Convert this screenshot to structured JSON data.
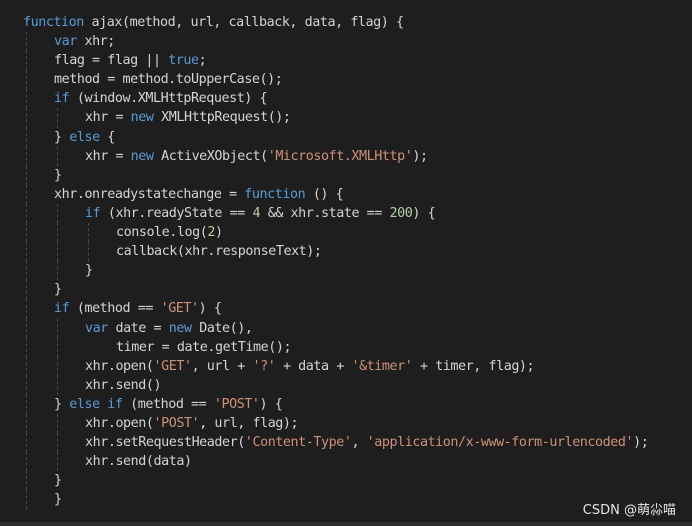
{
  "code_lines": [
    {
      "indent": 0,
      "guides": [],
      "tokens": [
        [
          "function",
          "kw"
        ],
        [
          " ajax(method, url, callback, data, flag) {",
          "pun"
        ]
      ]
    },
    {
      "indent": 1,
      "guides": [
        0
      ],
      "tokens": [
        [
          "var",
          "kw"
        ],
        [
          " xhr;",
          "pun"
        ]
      ]
    },
    {
      "indent": 1,
      "guides": [
        0
      ],
      "tokens": [
        [
          "flag = flag || ",
          "pun"
        ],
        [
          "true",
          "kw"
        ],
        [
          ";",
          "pun"
        ]
      ]
    },
    {
      "indent": 1,
      "guides": [
        0
      ],
      "tokens": [
        [
          "method = method.toUpperCase();",
          "pun"
        ]
      ]
    },
    {
      "indent": 1,
      "guides": [
        0
      ],
      "tokens": [
        [
          "if",
          "kw"
        ],
        [
          " (window.XMLHttpRequest) {",
          "pun"
        ]
      ]
    },
    {
      "indent": 2,
      "guides": [
        0,
        1
      ],
      "tokens": [
        [
          "xhr = ",
          "pun"
        ],
        [
          "new",
          "kw"
        ],
        [
          " XMLHttpRequest();",
          "pun"
        ]
      ]
    },
    {
      "indent": 1,
      "guides": [
        0
      ],
      "tokens": [
        [
          "} ",
          "pun"
        ],
        [
          "else",
          "kw"
        ],
        [
          " {",
          "pun"
        ]
      ]
    },
    {
      "indent": 2,
      "guides": [
        0,
        1
      ],
      "tokens": [
        [
          "xhr = ",
          "pun"
        ],
        [
          "new",
          "kw"
        ],
        [
          " ActiveXObject(",
          "pun"
        ],
        [
          "'Microsoft.XMLHttp'",
          "str"
        ],
        [
          ");",
          "pun"
        ]
      ]
    },
    {
      "indent": 1,
      "guides": [
        0
      ],
      "tokens": [
        [
          "}",
          "pun"
        ]
      ]
    },
    {
      "indent": 1,
      "guides": [
        0
      ],
      "tokens": [
        [
          "xhr.onreadystatechange = ",
          "pun"
        ],
        [
          "function",
          "kw"
        ],
        [
          " () {",
          "pun"
        ]
      ]
    },
    {
      "indent": 2,
      "guides": [
        0,
        1
      ],
      "tokens": [
        [
          "if",
          "kw"
        ],
        [
          " (xhr.readyState == ",
          "pun"
        ],
        [
          "4",
          "num"
        ],
        [
          " && xhr.state == ",
          "pun"
        ],
        [
          "200",
          "num"
        ],
        [
          ") {",
          "pun"
        ]
      ]
    },
    {
      "indent": 3,
      "guides": [
        0,
        1,
        2
      ],
      "tokens": [
        [
          "console.log(",
          "pun"
        ],
        [
          "2",
          "num"
        ],
        [
          ")",
          "pun"
        ]
      ]
    },
    {
      "indent": 3,
      "guides": [
        0,
        1,
        2
      ],
      "tokens": [
        [
          "callback(xhr.responseText);",
          "pun"
        ]
      ]
    },
    {
      "indent": 2,
      "guides": [
        0,
        1
      ],
      "tokens": [
        [
          "}",
          "pun"
        ]
      ]
    },
    {
      "indent": 1,
      "guides": [
        0
      ],
      "tokens": [
        [
          "}",
          "pun"
        ]
      ]
    },
    {
      "indent": 1,
      "guides": [
        0
      ],
      "tokens": [
        [
          "if",
          "kw"
        ],
        [
          " (method == ",
          "pun"
        ],
        [
          "'GET'",
          "str"
        ],
        [
          ") {",
          "pun"
        ]
      ]
    },
    {
      "indent": 2,
      "guides": [
        0,
        1
      ],
      "tokens": [
        [
          "var",
          "kw"
        ],
        [
          " date = ",
          "pun"
        ],
        [
          "new",
          "kw"
        ],
        [
          " Date(),",
          "pun"
        ]
      ]
    },
    {
      "indent": 3,
      "guides": [
        0,
        1
      ],
      "tokens": [
        [
          "timer = date.getTime();",
          "pun"
        ]
      ]
    },
    {
      "indent": 2,
      "guides": [
        0,
        1
      ],
      "tokens": [
        [
          "xhr.open(",
          "pun"
        ],
        [
          "'GET'",
          "str"
        ],
        [
          ", url + ",
          "pun"
        ],
        [
          "'?'",
          "str"
        ],
        [
          " + data + ",
          "pun"
        ],
        [
          "'&timer'",
          "str"
        ],
        [
          " + timer, flag);",
          "pun"
        ]
      ]
    },
    {
      "indent": 2,
      "guides": [
        0,
        1
      ],
      "tokens": [
        [
          "xhr.send()",
          "pun"
        ]
      ]
    },
    {
      "indent": 1,
      "guides": [
        0
      ],
      "tokens": [
        [
          "} ",
          "pun"
        ],
        [
          "else if",
          "kw"
        ],
        [
          " (method == ",
          "pun"
        ],
        [
          "'POST'",
          "str"
        ],
        [
          ") {",
          "pun"
        ]
      ]
    },
    {
      "indent": 2,
      "guides": [
        0,
        1
      ],
      "tokens": [
        [
          "xhr.open(",
          "pun"
        ],
        [
          "'POST'",
          "str"
        ],
        [
          ", url, flag);",
          "pun"
        ]
      ]
    },
    {
      "indent": 2,
      "guides": [
        0,
        1
      ],
      "tokens": [
        [
          "xhr.setRequestHeader(",
          "pun"
        ],
        [
          "'Content-Type'",
          "str"
        ],
        [
          ", ",
          "pun"
        ],
        [
          "'application/x-www-form-urlencoded'",
          "str"
        ],
        [
          ");",
          "pun"
        ]
      ]
    },
    {
      "indent": 2,
      "guides": [
        0,
        1
      ],
      "tokens": [
        [
          "xhr.send(data)",
          "pun"
        ]
      ]
    },
    {
      "indent": 1,
      "guides": [
        0
      ],
      "tokens": [
        [
          "}",
          "pun"
        ]
      ]
    },
    {
      "indent": 1,
      "guides": [
        0
      ],
      "tokens": [
        [
          "}",
          "pun"
        ]
      ]
    }
  ],
  "watermark": "CSDN @萌尛喵",
  "colors": {
    "background": "#1e1e1e",
    "keyword": "#569cd6",
    "string": "#ce9178",
    "number": "#b5cea8",
    "text": "#d4d4d4"
  }
}
